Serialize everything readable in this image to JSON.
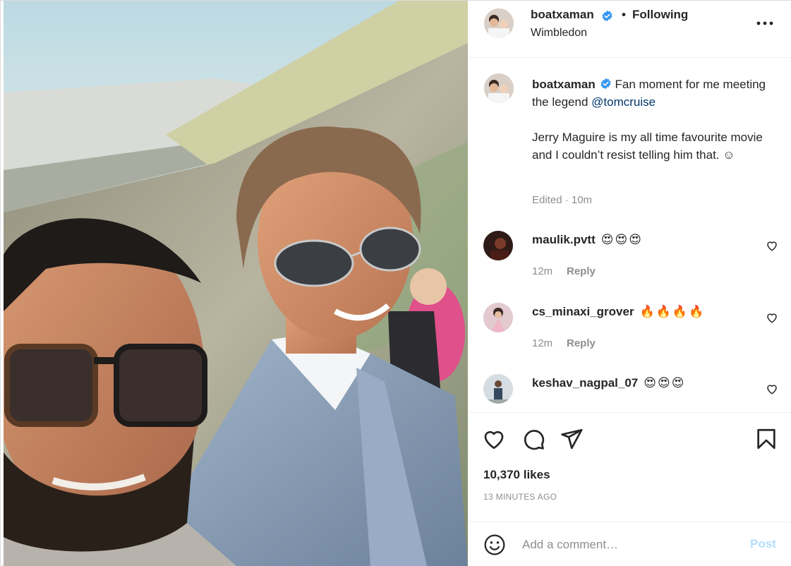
{
  "post": {
    "username": "boatxaman",
    "follow_status": "Following",
    "separator": "•",
    "location": "Wimbledon",
    "photo_alt": "Selfie at Wimbledon"
  },
  "caption": {
    "username": "boatxaman",
    "text_before_mention": "Fan moment for me meeting the legend ",
    "mention": "@tomcruise",
    "text_after": "Jerry Maguire is my all time favourite movie and I couldn’t resist telling him that. ☺",
    "edited": "Edited · 10m"
  },
  "comments": [
    {
      "username": "maulik.pvtt",
      "text": "😍😍😍",
      "time": "12m",
      "reply": "Reply"
    },
    {
      "username": "cs_minaxi_grover",
      "text": "🔥🔥🔥🔥",
      "time": "12m",
      "reply": "Reply"
    },
    {
      "username": "keshav_nagpal_07",
      "text": "😍😍😍",
      "time": "",
      "reply": ""
    }
  ],
  "actions": {
    "likes": "10,370 likes",
    "time_ago": "13 MINUTES AGO"
  },
  "add_comment": {
    "placeholder": "Add a comment…",
    "post_label": "Post"
  },
  "icons": {
    "verified": "verified-badge-icon",
    "more": "more-options-icon",
    "like": "heart-icon",
    "comment": "comment-icon",
    "share": "share-icon",
    "save": "bookmark-icon",
    "emoji": "emoji-icon"
  },
  "colors": {
    "verified_blue": "#3897f0",
    "mention": "#00376b",
    "muted": "#8e8e8e",
    "post_disabled": "#b2dffc"
  }
}
